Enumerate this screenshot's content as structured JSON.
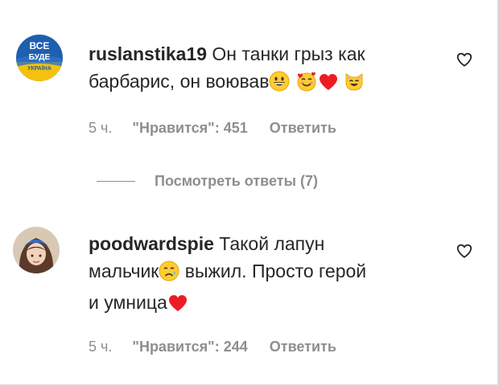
{
  "comments": [
    {
      "username": "ruslanstika19",
      "text_line1": "Он танки грыз как",
      "text_line2": "барбарис, он воював",
      "time": "5 ч.",
      "likes": "\"Нравится\": 451",
      "reply": "Ответить",
      "avatar_text": [
        "ВСЕ",
        "БУДЕ",
        "УКРАЇНА"
      ],
      "emojis": [
        "grinning-face",
        "smiling-face-with-hearts",
        "red-heart",
        "cat-face"
      ]
    },
    {
      "username": "poodwardspie",
      "text_line1": "Такой лапун",
      "text_line2_a": "мальчик",
      "text_line2_b": " выжил. Просто герой",
      "text_line3": "и умница",
      "time": "5 ч.",
      "likes": "\"Нравится\": 244",
      "reply": "Ответить",
      "emojis": [
        "sad-relieved-face",
        "red-heart"
      ]
    }
  ],
  "view_replies": "Посмотреть ответы (7)",
  "icons": {
    "like": "heart-outline-icon"
  },
  "colors": {
    "text": "#262626",
    "secondary": "#8e8e8e",
    "heart": "#ed1c24",
    "emoji_yellow": "#ffcc33"
  }
}
